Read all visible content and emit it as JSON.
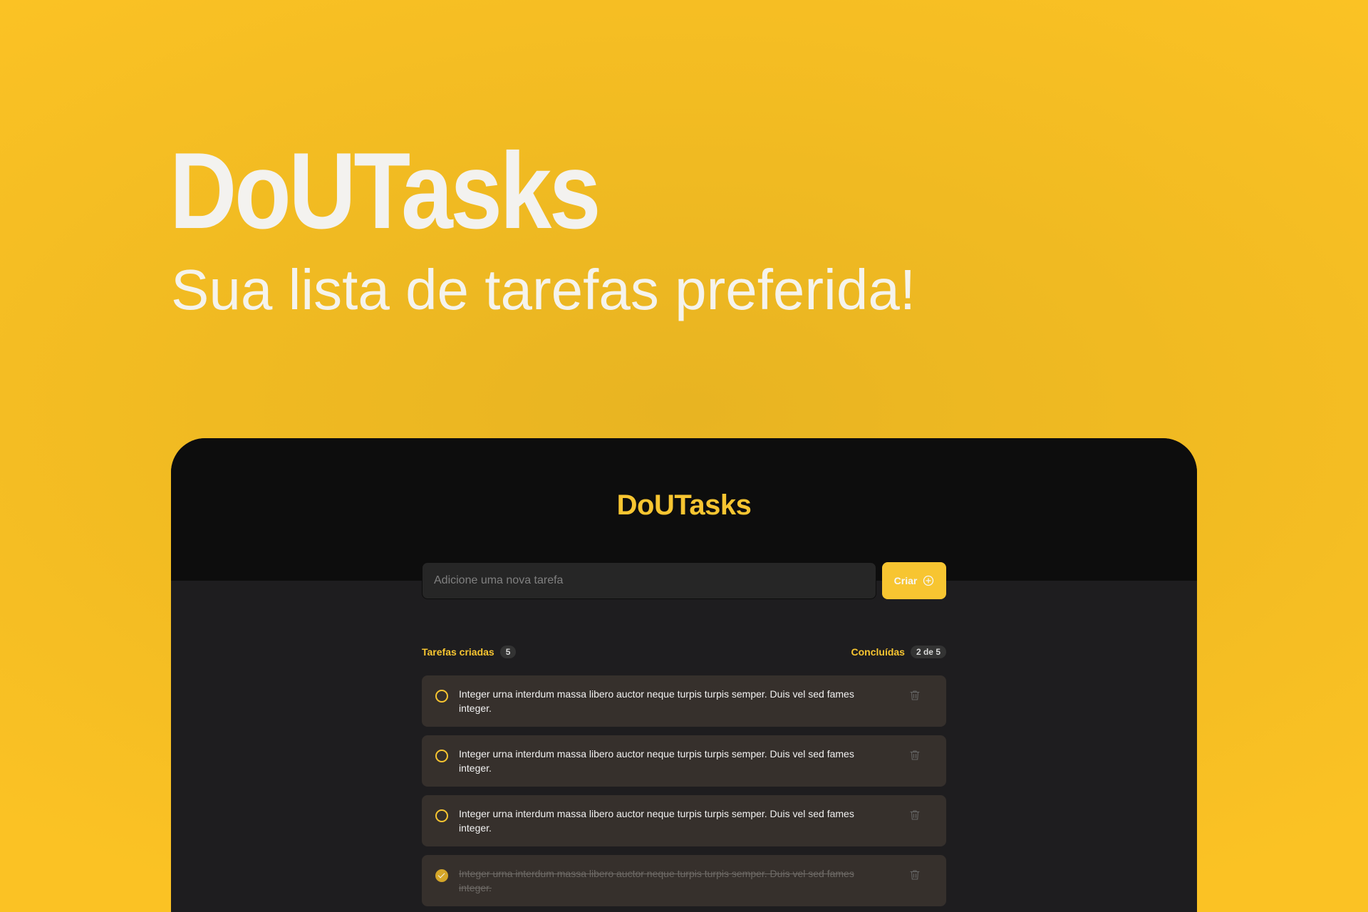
{
  "hero": {
    "title": "DoUTasks",
    "subtitle": "Sua lista de tarefas preferida!"
  },
  "app": {
    "logo": "DoUTasks",
    "input": {
      "placeholder": "Adicione uma nova tarefa",
      "value": ""
    },
    "create_button_label": "Criar",
    "counters": {
      "created_label": "Tarefas criadas",
      "created_count": "5",
      "done_label": "Concluídas",
      "done_count": "2 de 5"
    },
    "tasks": [
      {
        "text": "Integer urna interdum massa libero auctor neque turpis turpis semper. Duis vel sed fames integer.",
        "done": false
      },
      {
        "text": "Integer urna interdum massa libero auctor neque turpis turpis semper. Duis vel sed fames integer.",
        "done": false
      },
      {
        "text": "Integer urna interdum massa libero auctor neque turpis turpis semper. Duis vel sed fames integer.",
        "done": false
      },
      {
        "text": "Integer urna interdum massa libero auctor neque turpis turpis semper. Duis vel sed fames integer.",
        "done": true
      }
    ]
  },
  "colors": {
    "background_yellow": "#fbc224",
    "accent": "#f7c531",
    "header_dark": "#0d0d0d",
    "panel_dark": "#1e1d1f",
    "task_card": "#36302c"
  },
  "icons": {
    "create": "plus-circle-icon",
    "delete": "trash-icon",
    "unchecked": "circle-icon",
    "checked": "check-circle-icon"
  }
}
